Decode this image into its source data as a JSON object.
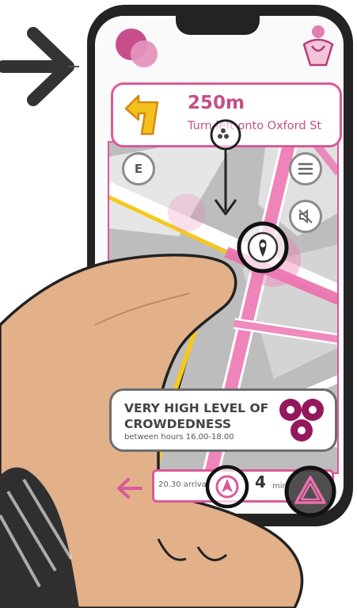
{
  "colors": {
    "accent": "#d95a9b",
    "accent_dark": "#a83572",
    "crowd_purple": "#93185c",
    "warning_yellow": "#f4c01e",
    "phone_body": "#232323"
  },
  "navigation": {
    "distance": "250m",
    "instruction": "Turn left onto Oxford St",
    "turn_icon": "turn-left-arrow-icon"
  },
  "map": {
    "controls": {
      "compass_label": "E",
      "menu_icon": "menu-icon",
      "mute_icon": "mute-icon"
    },
    "marker_icon": "location-marker-icon"
  },
  "crowd_alert": {
    "title": "VERY HIGH LEVEL OF CROWDEDNESS",
    "subtitle": "between hours 16.00-18.00",
    "icon": "crowd-indicator-icon"
  },
  "bottom_bar": {
    "arrival_time": "20.30 arrival",
    "minutes_value": "4",
    "minutes_unit": "min"
  }
}
